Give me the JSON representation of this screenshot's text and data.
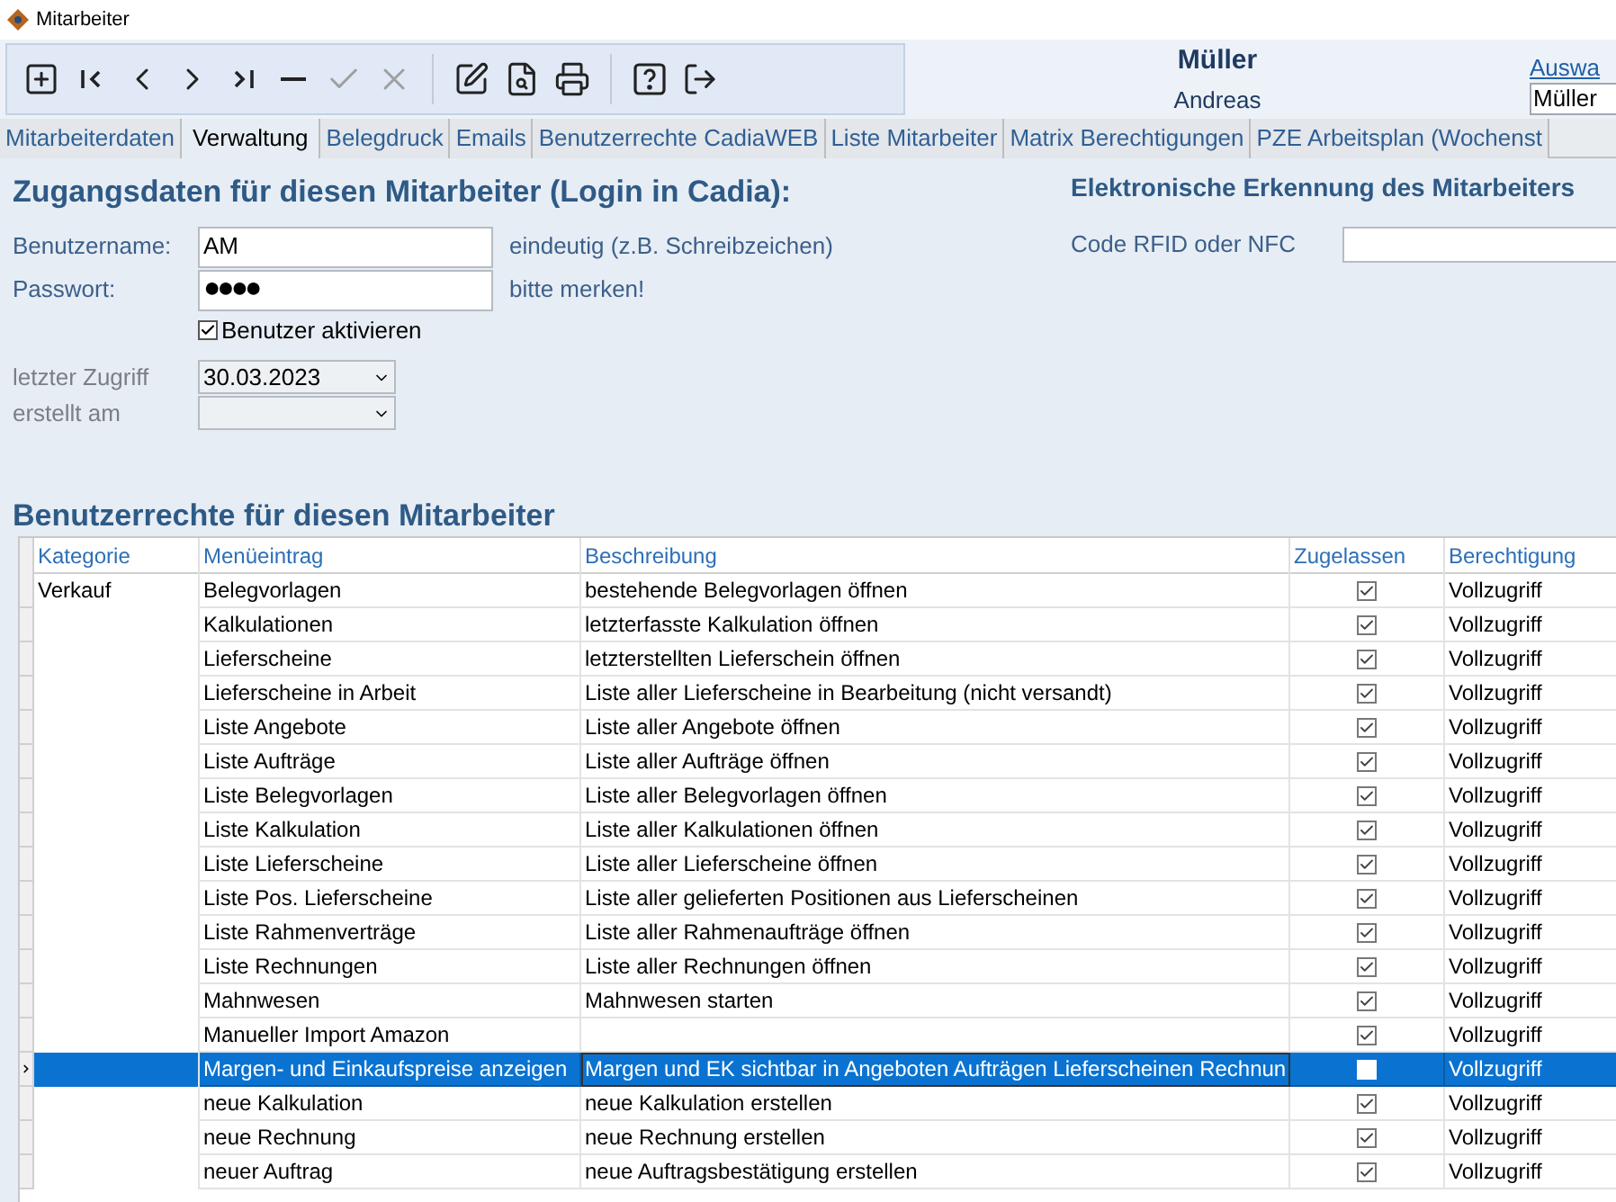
{
  "window": {
    "title": "Mitarbeiter"
  },
  "toolbar": [
    {
      "kind": "add",
      "disabled": false
    },
    {
      "kind": "first",
      "disabled": false
    },
    {
      "kind": "prev",
      "disabled": false
    },
    {
      "kind": "next",
      "disabled": false
    },
    {
      "kind": "last",
      "disabled": false
    },
    {
      "kind": "delete",
      "disabled": false
    },
    {
      "kind": "save",
      "disabled": true
    },
    {
      "kind": "cancel",
      "disabled": true
    },
    {
      "kind": "sep"
    },
    {
      "kind": "edit",
      "disabled": false
    },
    {
      "kind": "search",
      "disabled": false
    },
    {
      "kind": "print",
      "disabled": false
    },
    {
      "kind": "sep"
    },
    {
      "kind": "help",
      "disabled": false
    },
    {
      "kind": "exit",
      "disabled": false
    }
  ],
  "employee": {
    "last_name": "Müller",
    "first_name": "Andreas"
  },
  "selection": {
    "label": "Auswa",
    "value": "Müller"
  },
  "tabs": [
    {
      "label": "Mitarbeiterdaten",
      "selected": false
    },
    {
      "label": "Verwaltung",
      "selected": true
    },
    {
      "label": "Belegdruck",
      "selected": false
    },
    {
      "label": "Emails",
      "selected": false
    },
    {
      "label": "Benutzerrechte CadiaWEB",
      "selected": false
    },
    {
      "label": "Liste Mitarbeiter",
      "selected": false
    },
    {
      "label": "Matrix Berechtigungen",
      "selected": false
    },
    {
      "label": "PZE Arbeitsplan (Wochenst",
      "selected": false
    }
  ],
  "login": {
    "heading": "Zugangsdaten für diesen Mitarbeiter (Login in Cadia):",
    "username": {
      "label": "Benutzername:",
      "value": "AM",
      "hint": "eindeutig (z.B. Schreibzeichen)"
    },
    "password": {
      "label": "Passwort:",
      "value": "●●●●",
      "hint": "bitte merken!"
    },
    "activate": {
      "label": "Benutzer aktivieren",
      "checked": true
    },
    "last_access": {
      "label": "letzter Zugriff",
      "value": "30.03.2023"
    },
    "created": {
      "label": "erstellt am"
    }
  },
  "recognition": {
    "heading": "Elektronische Erkennung des Mitarbeiters",
    "code_label": "Code RFID oder NFC"
  },
  "rights": {
    "heading": "Benutzerrechte für diesen Mitarbeiter",
    "columns": [
      "Kategorie",
      "Menüeintrag",
      "Beschreibung",
      "Zugelassen",
      "Berechtigung"
    ],
    "rows": [
      {
        "category": "Verkauf",
        "entry": "Belegvorlagen",
        "description": "bestehende Belegvorlagen öffnen",
        "allowed": true,
        "permission": "Vollzugriff",
        "selected": false
      },
      {
        "entry": "Kalkulationen",
        "description": "letzterfasste Kalkulation öffnen",
        "allowed": true,
        "permission": "Vollzugriff",
        "selected": false
      },
      {
        "entry": "Lieferscheine",
        "description": "letzterstellten Lieferschein öffnen",
        "allowed": true,
        "permission": "Vollzugriff",
        "selected": false
      },
      {
        "entry": "Lieferscheine in Arbeit",
        "description": "Liste aller Lieferscheine in Bearbeitung (nicht versandt)",
        "allowed": true,
        "permission": "Vollzugriff",
        "selected": false
      },
      {
        "entry": "Liste Angebote",
        "description": "Liste aller Angebote öffnen",
        "allowed": true,
        "permission": "Vollzugriff",
        "selected": false
      },
      {
        "entry": "Liste Aufträge",
        "description": "Liste aller Aufträge öffnen",
        "allowed": true,
        "permission": "Vollzugriff",
        "selected": false
      },
      {
        "entry": "Liste Belegvorlagen",
        "description": "Liste aller Belegvorlagen öffnen",
        "allowed": true,
        "permission": "Vollzugriff",
        "selected": false
      },
      {
        "entry": "Liste Kalkulation",
        "description": "Liste aller Kalkulationen öffnen",
        "allowed": true,
        "permission": "Vollzugriff",
        "selected": false
      },
      {
        "entry": "Liste Lieferscheine",
        "description": "Liste aller Lieferscheine öffnen",
        "allowed": true,
        "permission": "Vollzugriff",
        "selected": false
      },
      {
        "entry": "Liste Pos. Lieferscheine",
        "description": "Liste aller gelieferten Positionen aus Lieferscheinen",
        "allowed": true,
        "permission": "Vollzugriff",
        "selected": false
      },
      {
        "entry": "Liste Rahmenverträge",
        "description": "Liste aller Rahmenaufträge öffnen",
        "allowed": true,
        "permission": "Vollzugriff",
        "selected": false
      },
      {
        "entry": "Liste Rechnungen",
        "description": "Liste aller Rechnungen öffnen",
        "allowed": true,
        "permission": "Vollzugriff",
        "selected": false
      },
      {
        "entry": "Mahnwesen",
        "description": "Mahnwesen starten",
        "allowed": true,
        "permission": "Vollzugriff",
        "selected": false
      },
      {
        "entry": "Manueller Import Amazon",
        "allowed": true,
        "permission": "Vollzugriff",
        "selected": false
      },
      {
        "entry": "Margen- und Einkaufspreise anzeigen",
        "description": "Margen und EK sichtbar in Angeboten Aufträgen Lieferscheinen Rechnun",
        "allowed": false,
        "permission": "Vollzugriff",
        "selected": true
      },
      {
        "entry": "neue Kalkulation",
        "description": "neue Kalkulation erstellen",
        "allowed": true,
        "permission": "Vollzugriff",
        "selected": false
      },
      {
        "entry": "neue Rechnung",
        "description": "neue Rechnung erstellen",
        "allowed": true,
        "permission": "Vollzugriff",
        "selected": false
      },
      {
        "entry": "neuer Auftrag",
        "description": "neue Auftragsbestätigung erstellen",
        "allowed": true,
        "permission": "Vollzugriff",
        "selected": false
      }
    ]
  }
}
